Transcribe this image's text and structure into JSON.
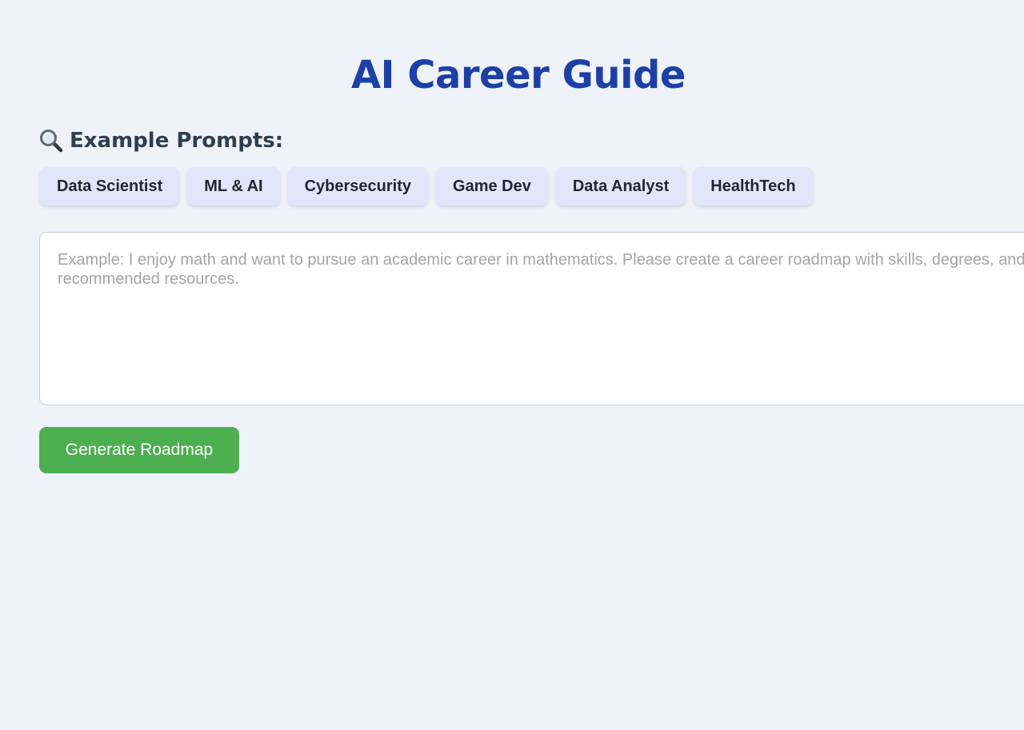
{
  "header": {
    "title": "AI Career Guide"
  },
  "examples": {
    "heading": "Example Prompts:",
    "icon": "magnifying-glass-icon",
    "chips": [
      {
        "label": "Data Scientist"
      },
      {
        "label": "ML & AI"
      },
      {
        "label": "Cybersecurity"
      },
      {
        "label": "Game Dev"
      },
      {
        "label": "Data Analyst"
      },
      {
        "label": "HealthTech"
      }
    ]
  },
  "prompt": {
    "value": "",
    "placeholder": "Example: I enjoy math and want to pursue an academic career in mathematics. Please create a career roadmap with skills, degrees, and recommended resources."
  },
  "actions": {
    "generate_label": "Generate Roadmap"
  },
  "colors": {
    "background": "#eff3f9",
    "title": "#1c3faa",
    "chip_background": "#e2e6fb",
    "primary_button": "#4caf50"
  }
}
